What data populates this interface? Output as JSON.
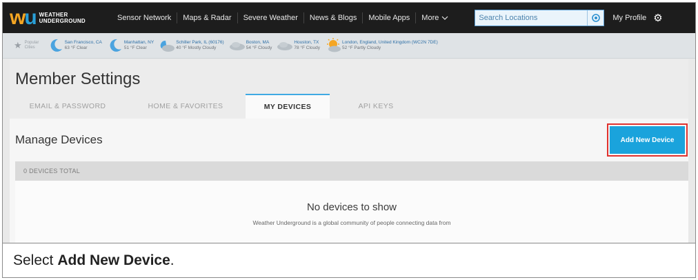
{
  "nav": {
    "logo_line1": "WEATHER",
    "logo_line2": "UNDERGROUND",
    "items": [
      "Sensor Network",
      "Maps & Radar",
      "Severe Weather",
      "News & Blogs",
      "Mobile Apps"
    ],
    "more_label": "More",
    "search_placeholder": "Search Locations",
    "profile_label": "My Profile"
  },
  "favorites": {
    "label_line1": "Popular",
    "label_line2": "Cities",
    "cities": [
      {
        "name": "San Francisco, CA",
        "cond": "63 °F Clear",
        "icon": "moon-icon"
      },
      {
        "name": "Manhattan, NY",
        "cond": "51 °F Clear",
        "icon": "moon-icon"
      },
      {
        "name": "Schiller Park, IL (60176)",
        "cond": "40 °F Mostly Cloudy",
        "icon": "mostly-cloudy-icon"
      },
      {
        "name": "Boston, MA",
        "cond": "54 °F Cloudy",
        "icon": "cloud-icon"
      },
      {
        "name": "Houston, TX",
        "cond": "78 °F Cloudy",
        "icon": "cloud-icon"
      },
      {
        "name": "London, England, United Kingdom (WC2N 7DE)",
        "cond": "52 °F Partly Cloudy",
        "icon": "partly-cloudy-icon"
      }
    ]
  },
  "page": {
    "title": "Member Settings",
    "tabs": [
      "EMAIL & PASSWORD",
      "HOME & FAVORITES",
      "MY DEVICES",
      "API KEYS"
    ],
    "active_tab": "MY DEVICES"
  },
  "devices": {
    "section_title": "Manage Devices",
    "add_button": "Add New Device",
    "total_label": "0 DEVICES TOTAL",
    "empty_title": "No devices to show",
    "empty_sub": "Weather Underground is a global community of people connecting data from"
  },
  "caption": {
    "prefix": "Select",
    "bold": "Add New Device",
    "suffix": "."
  },
  "colors": {
    "nav_bg": "#1d1d1d",
    "accent_blue": "#1aa3dc",
    "highlight_red": "#e0322e",
    "tab_active_border": "#3fa9e3"
  }
}
